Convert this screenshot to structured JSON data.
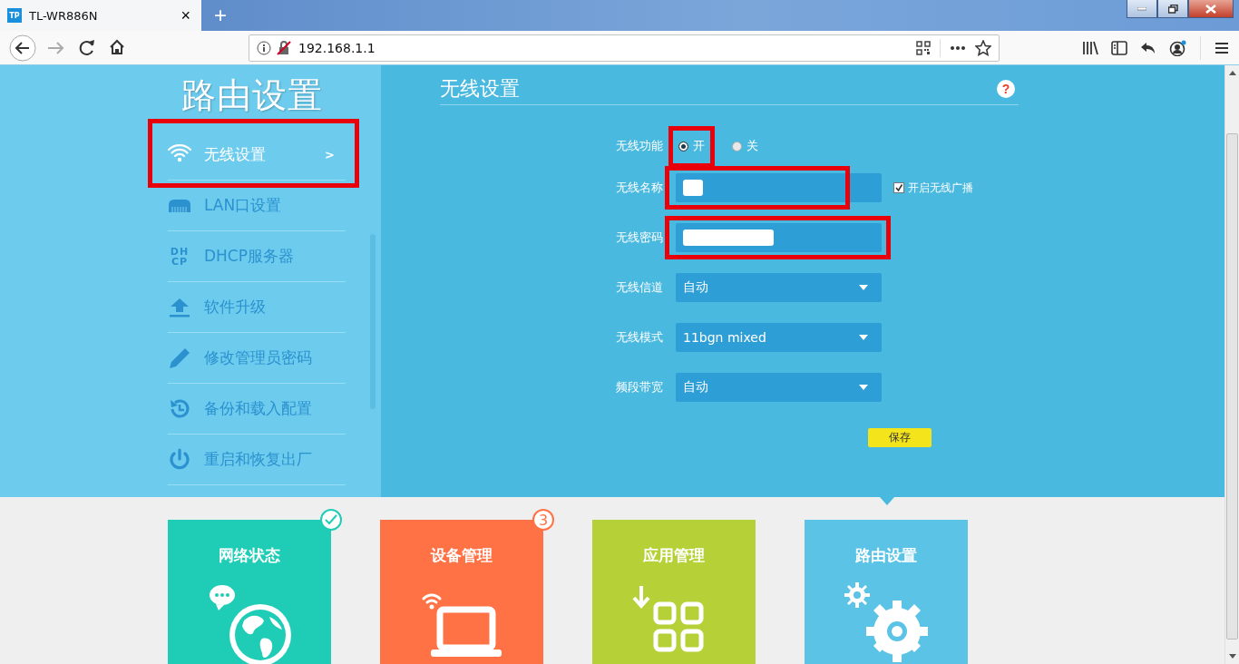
{
  "browser": {
    "tab": {
      "favicon": "TP",
      "title": "TL-WR886N",
      "close": "×"
    },
    "new_tab": "+",
    "address": "192.168.1.1"
  },
  "sidebar": {
    "title": "路由设置",
    "items": [
      {
        "kind": "wifi",
        "label": "无线设置",
        "selected": true,
        "highlighted": true,
        "arrow": ">"
      },
      {
        "kind": "lan",
        "label": "LAN口设置",
        "selected": false,
        "highlighted": false
      },
      {
        "kind": "dhcp",
        "label": "DHCP服务器",
        "icon_text": [
          "DH",
          "CP"
        ],
        "selected": false,
        "highlighted": false
      },
      {
        "kind": "upgrade",
        "label": "软件升级",
        "selected": false,
        "highlighted": false
      },
      {
        "kind": "password",
        "label": "修改管理员密码",
        "selected": false,
        "highlighted": false
      },
      {
        "kind": "backup",
        "label": "备份和载入配置",
        "selected": false,
        "highlighted": false
      },
      {
        "kind": "power",
        "label": "重启和恢复出厂",
        "selected": false,
        "highlighted": false
      }
    ]
  },
  "main": {
    "title": "无线设置",
    "help": "?",
    "fields": [
      {
        "kind": "radio",
        "label": "无线功能",
        "options": [
          {
            "label": "开",
            "selected": true,
            "highlighted": true
          },
          {
            "label": "关",
            "selected": false,
            "highlighted": false
          }
        ]
      },
      {
        "kind": "name",
        "label": "无线名称",
        "redacted": true,
        "highlighted": true,
        "checkbox": {
          "label": "开启无线广播",
          "checked": true
        }
      },
      {
        "kind": "secret",
        "label": "无线密码",
        "redacted": true,
        "highlighted": true
      },
      {
        "kind": "select",
        "label": "无线信道",
        "value": "自动"
      },
      {
        "kind": "select",
        "label": "无线模式",
        "value": "11bgn mixed"
      },
      {
        "kind": "select",
        "label": "频段带宽",
        "value": "自动"
      }
    ],
    "save": "保存"
  },
  "tiles": [
    {
      "kind": "globe",
      "label": "网络状态",
      "color": "#1fcdb6",
      "selected": false,
      "badge": {
        "kind": "check"
      }
    },
    {
      "kind": "laptop",
      "label": "设备管理",
      "color": "#fe7245",
      "selected": false,
      "badge": {
        "kind": "count",
        "text": "3"
      }
    },
    {
      "kind": "apps",
      "label": "应用管理",
      "color": "#b6d137",
      "selected": false
    },
    {
      "kind": "gear",
      "label": "路由设置",
      "color": "#5bc4e6",
      "selected": true
    }
  ]
}
